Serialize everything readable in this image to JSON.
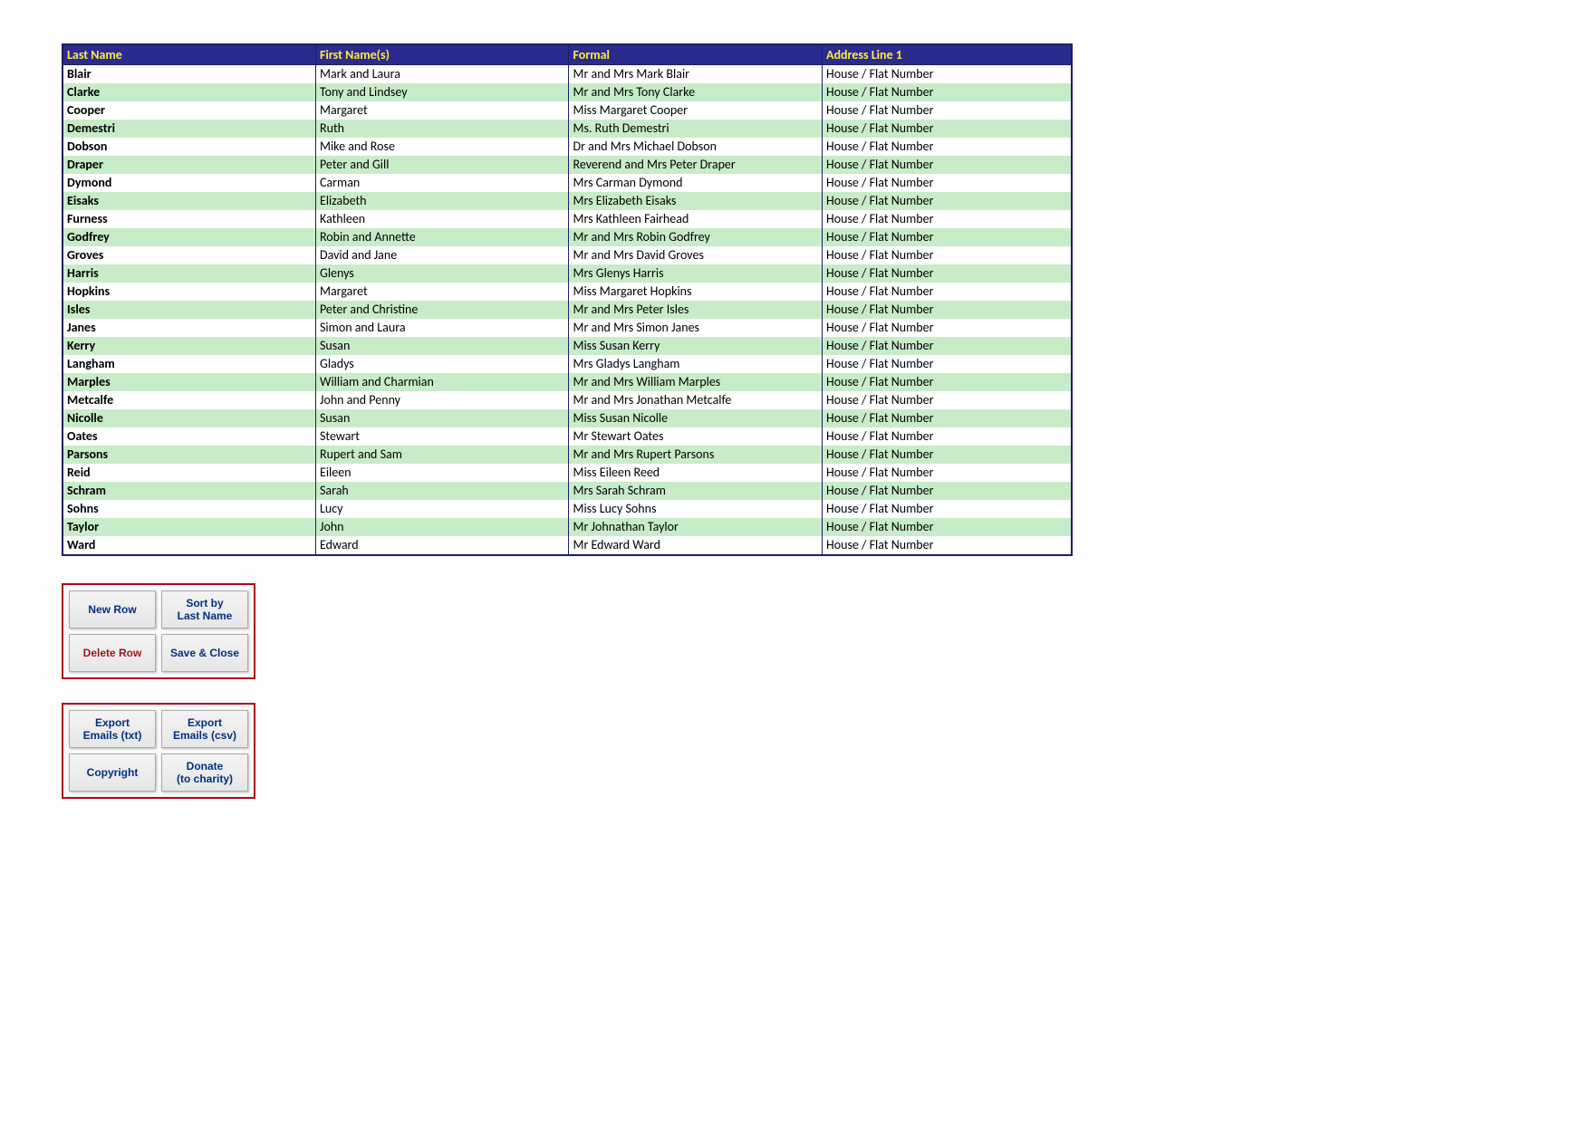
{
  "table": {
    "headers": [
      "Last Name",
      "First Name(s)",
      "Formal",
      "Address Line 1"
    ],
    "rows": [
      [
        "Blair",
        "Mark and Laura",
        "Mr and Mrs Mark Blair",
        "House / Flat Number"
      ],
      [
        "Clarke",
        "Tony and Lindsey",
        "Mr and Mrs Tony Clarke",
        "House / Flat Number"
      ],
      [
        "Cooper",
        "Margaret",
        "Miss Margaret Cooper",
        "House / Flat Number"
      ],
      [
        "Demestri",
        "Ruth",
        "Ms. Ruth Demestri",
        "House / Flat Number"
      ],
      [
        "Dobson",
        "Mike and Rose",
        "Dr and Mrs Michael Dobson",
        "House / Flat Number"
      ],
      [
        "Draper",
        "Peter and Gill",
        "Reverend and Mrs Peter Draper",
        "House / Flat Number"
      ],
      [
        "Dymond",
        "Carman",
        "Mrs Carman Dymond",
        "House / Flat Number"
      ],
      [
        "Eisaks",
        "Elizabeth",
        "Mrs Elizabeth Eisaks",
        "House / Flat Number"
      ],
      [
        "Furness",
        "Kathleen",
        "Mrs Kathleen Fairhead",
        "House / Flat Number"
      ],
      [
        "Godfrey",
        "Robin and Annette",
        "Mr and Mrs Robin Godfrey",
        "House / Flat Number"
      ],
      [
        "Groves",
        "David and Jane",
        "Mr and Mrs David Groves",
        "House / Flat Number"
      ],
      [
        "Harris",
        "Glenys",
        "Mrs Glenys Harris",
        "House / Flat Number"
      ],
      [
        "Hopkins",
        "Margaret",
        "Miss Margaret Hopkins",
        "House / Flat Number"
      ],
      [
        "Isles",
        "Peter and Christine",
        "Mr and Mrs Peter Isles",
        "House / Flat Number"
      ],
      [
        "Janes",
        "Simon and Laura",
        "Mr and Mrs Simon Janes",
        "House / Flat Number"
      ],
      [
        "Kerry",
        "Susan",
        "Miss Susan Kerry",
        "House / Flat Number"
      ],
      [
        "Langham",
        "Gladys",
        "Mrs Gladys Langham",
        "House / Flat Number"
      ],
      [
        "Marples",
        "William and Charmian",
        "Mr and Mrs William Marples",
        "House / Flat Number"
      ],
      [
        "Metcalfe",
        "John and Penny",
        "Mr and Mrs Jonathan Metcalfe",
        "House / Flat Number"
      ],
      [
        "Nicolle",
        "Susan",
        "Miss Susan Nicolle",
        "House / Flat Number"
      ],
      [
        "Oates",
        "Stewart",
        "Mr Stewart Oates",
        "House / Flat Number"
      ],
      [
        "Parsons",
        "Rupert and Sam",
        "Mr and Mrs Rupert Parsons",
        "House / Flat Number"
      ],
      [
        "Reid",
        "Eileen",
        "Miss Eileen Reed",
        "House / Flat Number"
      ],
      [
        "Schram",
        "Sarah",
        "Mrs Sarah Schram",
        "House / Flat Number"
      ],
      [
        "Sohns",
        "Lucy",
        "Miss Lucy Sohns",
        "House / Flat Number"
      ],
      [
        "Taylor",
        "John",
        "Mr Johnathan Taylor",
        "House / Flat Number"
      ],
      [
        "Ward",
        "Edward",
        "Mr Edward Ward",
        "House / Flat Number"
      ]
    ]
  },
  "buttons": {
    "panel1": {
      "new_row": "New Row",
      "sort": "Sort by\nLast Name",
      "delete_row": "Delete Row",
      "save_close": "Save & Close"
    },
    "panel2": {
      "export_txt": "Export\nEmails (txt)",
      "export_csv": "Export\nEmails (csv)",
      "copyright": "Copyright",
      "donate": "Donate\n(to charity)"
    }
  }
}
